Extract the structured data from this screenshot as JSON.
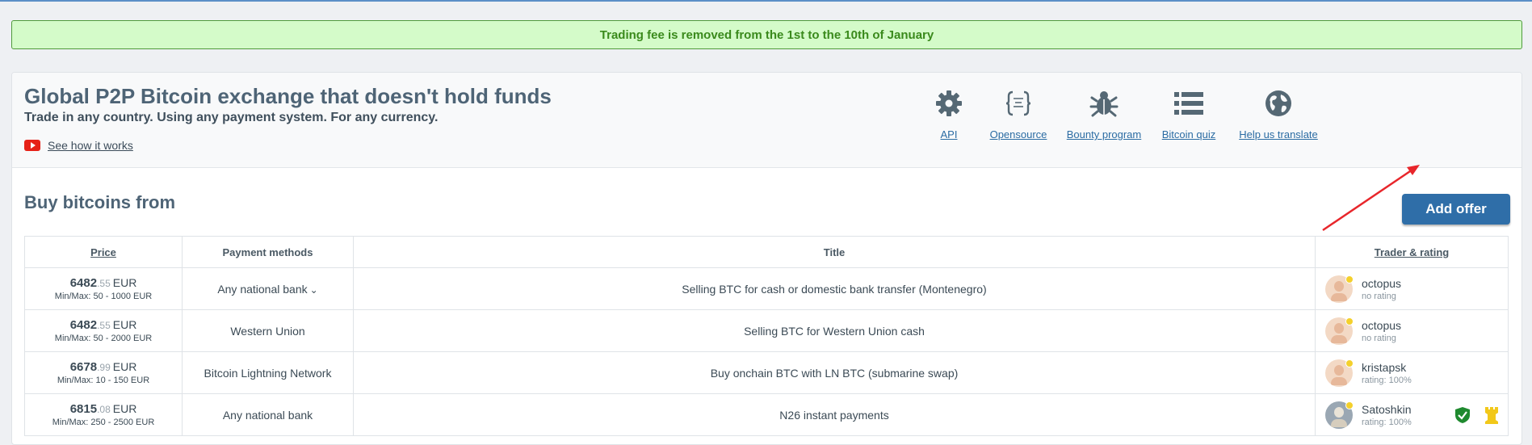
{
  "banner": {
    "text": "Trading fee is removed from the 1st to the 10th of January"
  },
  "hero": {
    "title": "Global P2P Bitcoin exchange that doesn't hold funds",
    "subtitle": "Trade in any country. Using any payment system. For any currency.",
    "how_link": "See how it works",
    "tools": [
      {
        "label": "API",
        "icon": "gear-icon"
      },
      {
        "label": "Opensource",
        "icon": "code-braces-icon"
      },
      {
        "label": "Bounty program",
        "icon": "bug-icon"
      },
      {
        "label": "Bitcoin quiz",
        "icon": "list-icon"
      },
      {
        "label": "Help us translate",
        "icon": "globe-icon"
      }
    ]
  },
  "section": {
    "title": "Buy bitcoins from",
    "add_offer": "Add offer"
  },
  "table": {
    "headers": {
      "price": "Price",
      "payment": "Payment methods",
      "title": "Title",
      "trader": "Trader & rating"
    },
    "rows": [
      {
        "price_int": "6482",
        "price_dec": ".55",
        "currency": "EUR",
        "minmax": "Min/Max: 50 - 1000 EUR",
        "payment": "Any national bank",
        "title": "Selling BTC for cash or domestic bank transfer (Montenegro)",
        "trader": "octopus",
        "rating": "no rating"
      },
      {
        "price_int": "6482",
        "price_dec": ".55",
        "currency": "EUR",
        "minmax": "Min/Max: 50 - 2000 EUR",
        "payment": "Western Union",
        "title": "Selling BTC for Western Union cash",
        "trader": "octopus",
        "rating": "no rating"
      },
      {
        "price_int": "6678",
        "price_dec": ".99",
        "currency": "EUR",
        "minmax": "Min/Max: 10 - 150 EUR",
        "payment": "Bitcoin Lightning Network",
        "title": "Buy onchain BTC with LN BTC (submarine swap)",
        "trader": "kristapsk",
        "rating": "rating: 100%"
      },
      {
        "price_int": "6815",
        "price_dec": ".08",
        "currency": "EUR",
        "minmax": "Min/Max: 250 - 2500 EUR",
        "payment": "Any national bank",
        "title": "N26 instant payments",
        "trader": "Satoshkin",
        "rating": "rating: 100%"
      }
    ]
  },
  "colors": {
    "banner_bg": "#d4fbc9",
    "banner_text": "#3a8a1c",
    "link": "#2b6ca3",
    "button": "#2f6ea8",
    "arrow": "#e8262b"
  }
}
